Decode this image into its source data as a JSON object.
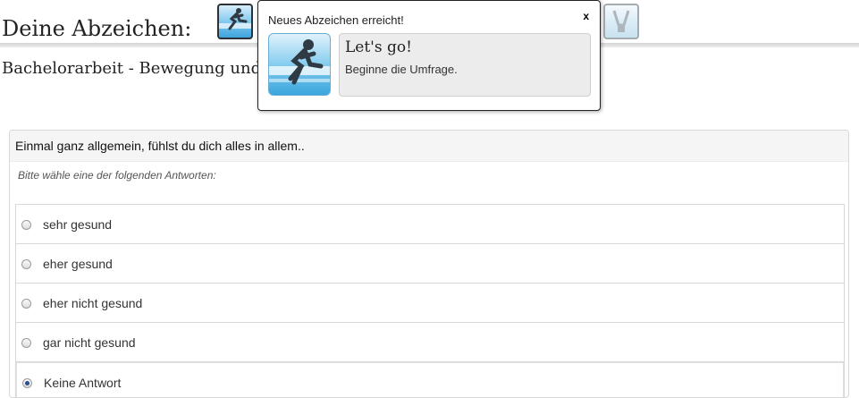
{
  "header": {
    "title": "Deine Abzeichen:",
    "badges": [
      {
        "icon": "runner-badge-icon",
        "state": "earned"
      },
      {
        "icon": "trophy-badge-icon",
        "state": "locked"
      }
    ]
  },
  "survey": {
    "title": "Bachelorarbeit - Bewegung und"
  },
  "question": {
    "text": "Einmal ganz allgemein, fühlst du dich alles in allem..",
    "help": "Bitte wähle eine der folgenden Antworten:",
    "answers": [
      {
        "label": "sehr gesund",
        "checked": false
      },
      {
        "label": "eher gesund",
        "checked": false
      },
      {
        "label": "eher nicht gesund",
        "checked": false
      },
      {
        "label": "gar nicht gesund",
        "checked": false
      },
      {
        "label": "Keine Antwort",
        "checked": true
      }
    ]
  },
  "popup": {
    "heading": "Neues Abzeichen erreicht!",
    "close_label": "x",
    "badge_name": "Let's go!",
    "badge_description": "Beginne die Umfrage.",
    "badge_icon": "runner-badge-icon"
  },
  "colors": {
    "badge_blue": "#3ea4dc",
    "selected_radio": "#2a4f8a"
  }
}
